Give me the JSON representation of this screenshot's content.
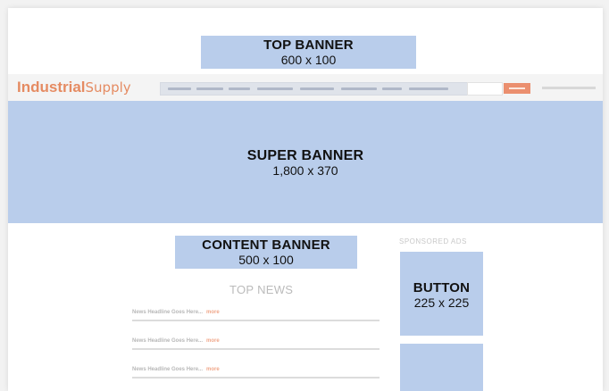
{
  "ads": {
    "top_banner": {
      "title": "TOP BANNER",
      "size": "600 x 100"
    },
    "super_banner": {
      "title": "SUPER BANNER",
      "size": "1,800 x 370"
    },
    "content_banner": {
      "title": "CONTENT BANNER",
      "size": "500 x 100"
    },
    "button": {
      "title": "BUTTON",
      "size": "225 x 225"
    }
  },
  "site": {
    "logo_bold": "Industrial",
    "logo_light": "Supply"
  },
  "sections": {
    "top_news": "TOP NEWS",
    "sponsored_ads": "SPONSORED ADS"
  },
  "news": [
    {
      "headline": "News Headline Goes Here...",
      "more": "more"
    },
    {
      "headline": "News Headline Goes Here...",
      "more": "more"
    },
    {
      "headline": "News Headline Goes Here...",
      "more": "more"
    }
  ],
  "colors": {
    "ad_placeholder": "#b9cdeb",
    "brand_accent": "#e58b62",
    "link_accent": "#f0a78a"
  }
}
